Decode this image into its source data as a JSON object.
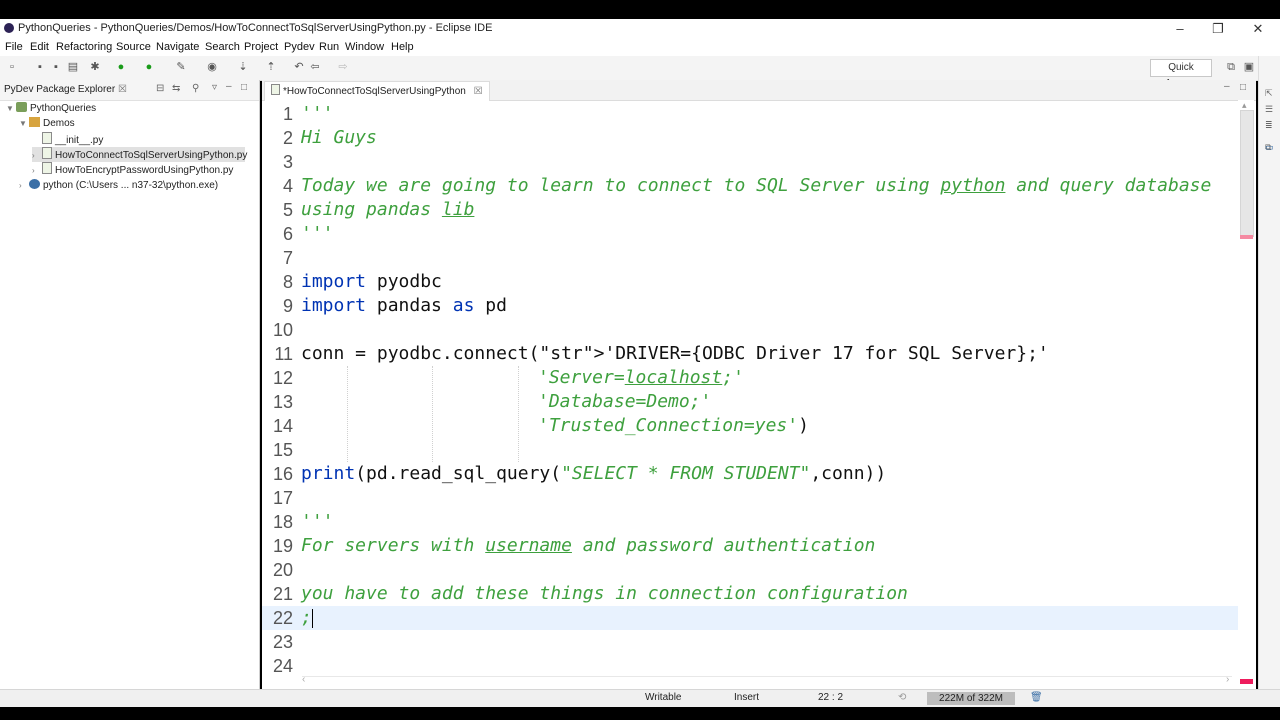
{
  "window": {
    "title": "PythonQueries - PythonQueries/Demos/HowToConnectToSqlServerUsingPython.py - Eclipse IDE"
  },
  "menu": [
    "File",
    "Edit",
    "Refactoring",
    "Source",
    "Navigate",
    "Search",
    "Project",
    "Pydev",
    "Run",
    "Window",
    "Help"
  ],
  "toolbar": {
    "quick_access": "Quick Access"
  },
  "explorer": {
    "title": "PyDev Package Explorer",
    "tree": [
      {
        "label": "PythonQueries"
      },
      {
        "label": "Demos"
      },
      {
        "label": "__init__.py"
      },
      {
        "label": "HowToConnectToSqlServerUsingPython.py"
      },
      {
        "label": "HowToEncryptPasswordUsingPython.py"
      },
      {
        "label": "python  (C:\\Users ... n37-32\\python.exe)"
      }
    ]
  },
  "editor": {
    "tab": "*HowToConnectToSqlServerUsingPython",
    "lines": [
      {
        "n": "1",
        "t": "'''"
      },
      {
        "n": "2",
        "t": "Hi Guys"
      },
      {
        "n": "3",
        "t": ""
      },
      {
        "n": "4",
        "t": "Today we are going to learn to connect to SQL Server using python and query database"
      },
      {
        "n": "5",
        "t": "using pandas lib"
      },
      {
        "n": "6",
        "t": "'''"
      },
      {
        "n": "7",
        "t": ""
      },
      {
        "n": "8",
        "t": "import pyodbc"
      },
      {
        "n": "9",
        "t": "import pandas as pd"
      },
      {
        "n": "10",
        "t": ""
      },
      {
        "n": "11",
        "t": "conn = pyodbc.connect('DRIVER={ODBC Driver 17 for SQL Server};'"
      },
      {
        "n": "12",
        "t": "'Server=localhost;'"
      },
      {
        "n": "13",
        "t": "'Database=Demo;'"
      },
      {
        "n": "14",
        "t": "'Trusted_Connection=yes')"
      },
      {
        "n": "15",
        "t": ""
      },
      {
        "n": "16",
        "t": "print(pd.read_sql_query(\"SELECT * FROM STUDENT\",conn))"
      },
      {
        "n": "17",
        "t": ""
      },
      {
        "n": "18",
        "t": "'''"
      },
      {
        "n": "19",
        "t": "For servers with username and password authentication"
      },
      {
        "n": "20",
        "t": ""
      },
      {
        "n": "21",
        "t": "you have to add these things in connection configuration"
      },
      {
        "n": "22",
        "t": ";"
      },
      {
        "n": "23",
        "t": ""
      },
      {
        "n": "24",
        "t": ""
      }
    ]
  },
  "status": {
    "mode": "Writable",
    "insert": "Insert",
    "position": "22 : 2",
    "heap": "222M of 322M"
  }
}
